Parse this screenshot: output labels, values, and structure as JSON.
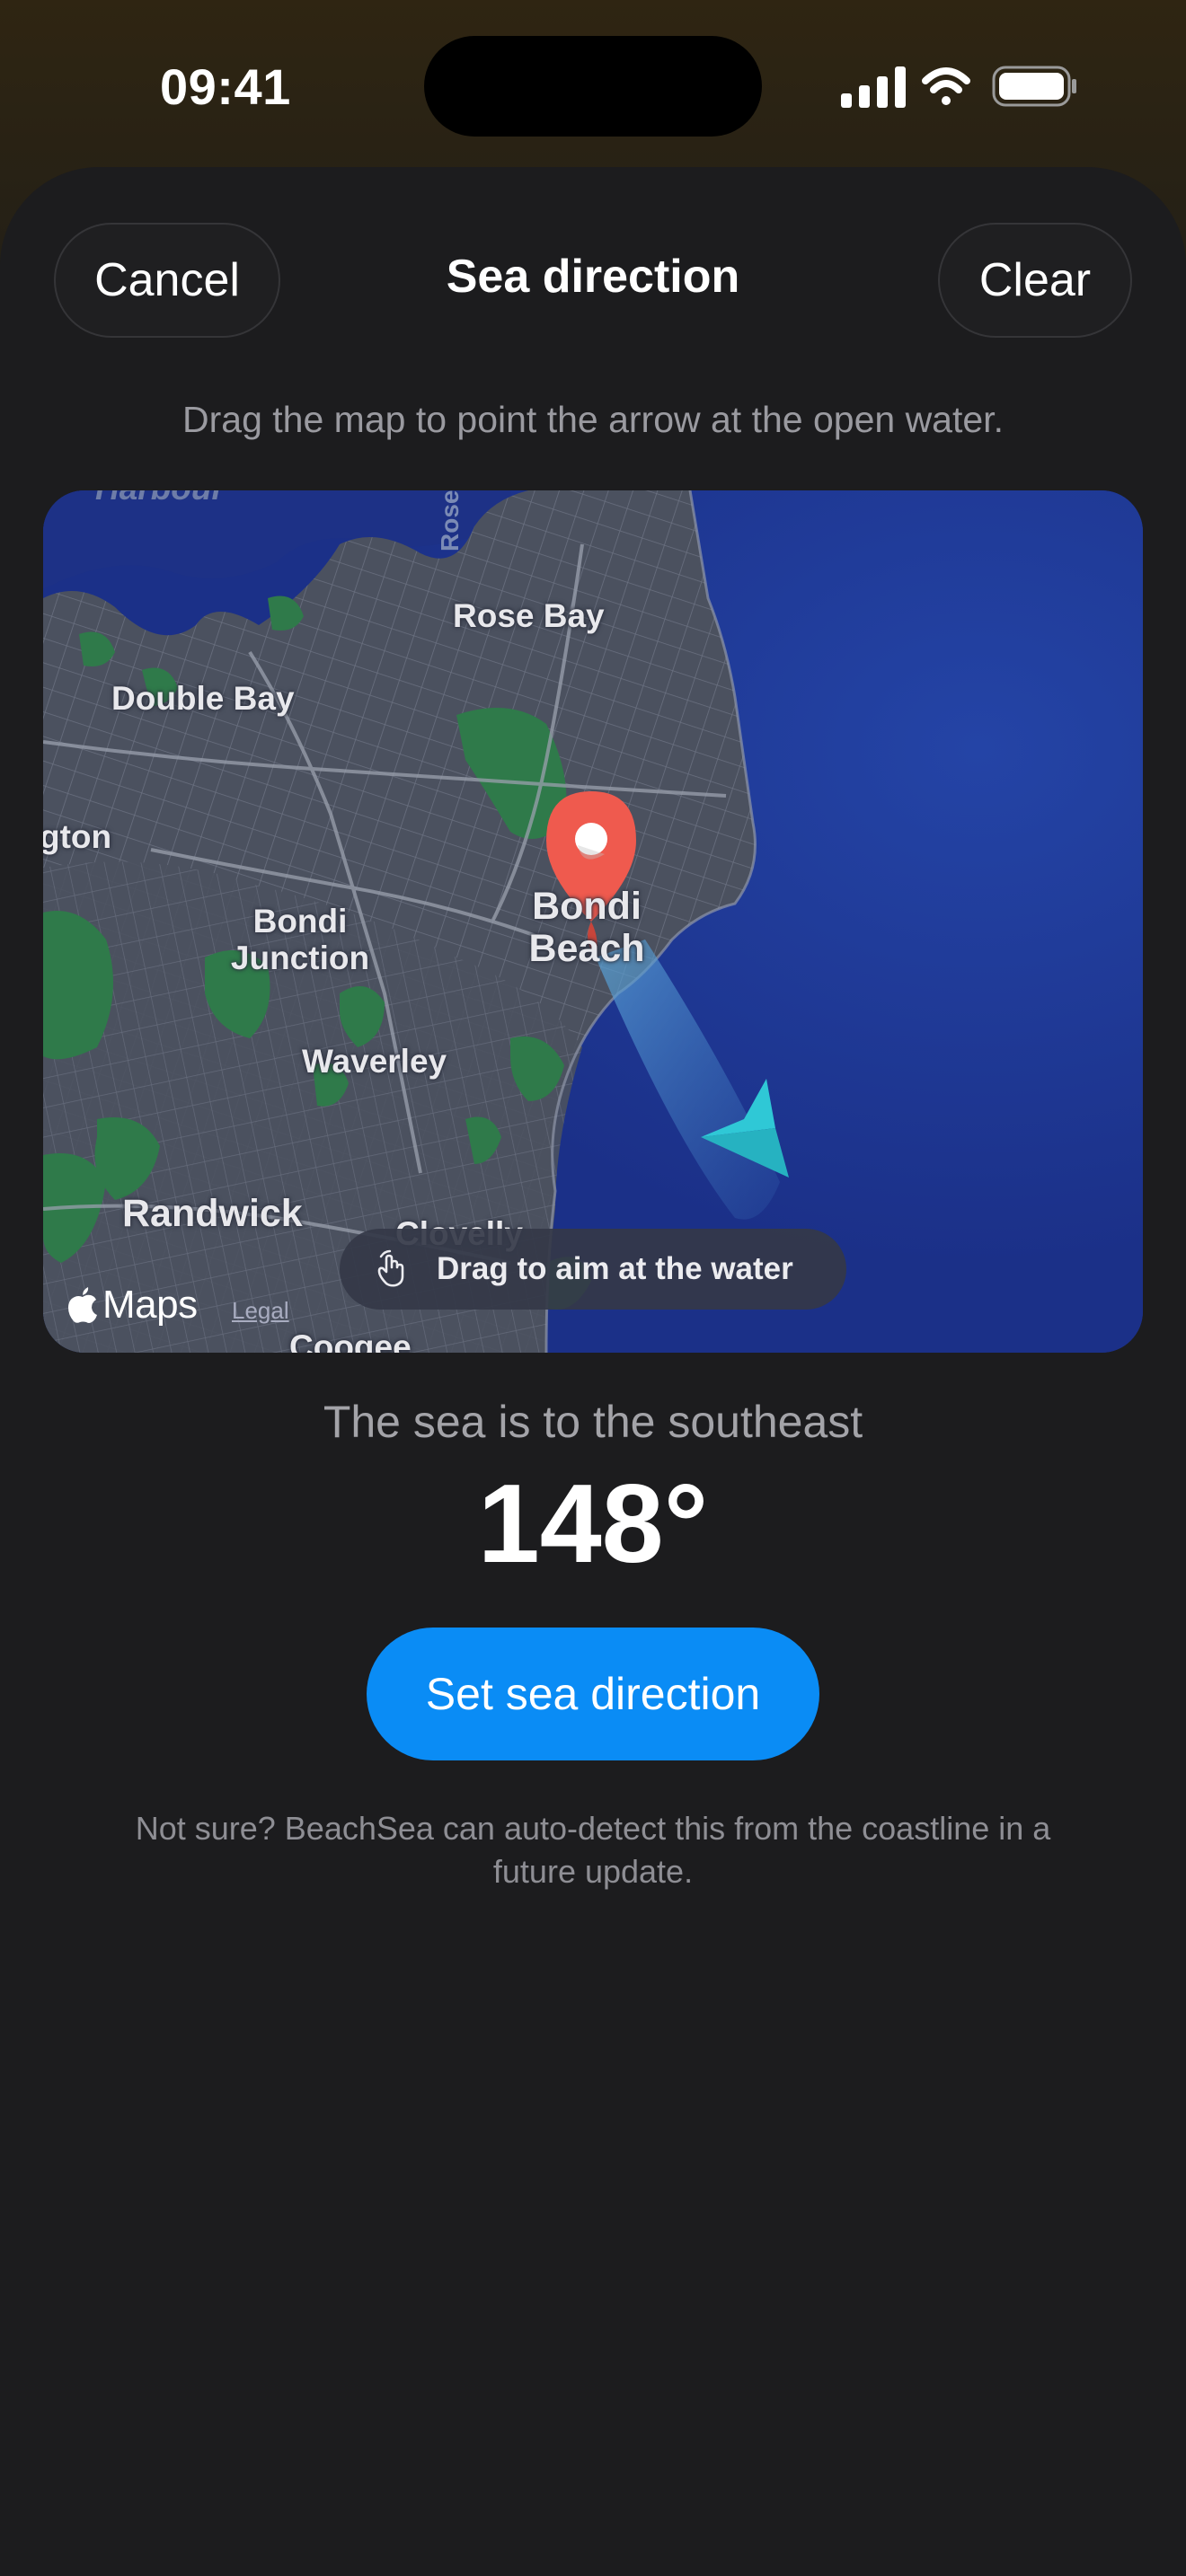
{
  "status_bar": {
    "time": "09:41"
  },
  "header": {
    "cancel_label": "Cancel",
    "title": "Sea direction",
    "clear_label": "Clear"
  },
  "instruction": "Drag the map to point the arrow at the open water.",
  "map": {
    "labels": {
      "harbour": "Harbour",
      "rose_bay_road": "Rose",
      "rose_bay": "Rose Bay",
      "double_bay": "Double Bay",
      "edgecliff": "gton",
      "bondi_junction": "Bondi\nJunction",
      "bondi_beach": "Bondi\nBeach",
      "waverley": "Waverley",
      "randwick": "Randwick",
      "clovelly": "Clovelly",
      "coogee": "Coogee"
    },
    "aim_hint": "Drag to aim at the water",
    "attribution_brand": "Maps",
    "legal": "Legal",
    "heading_degrees": 148,
    "colors": {
      "water": "#1d3388",
      "land": "#4a505e",
      "parks": "#2f7a4a",
      "pin": "#ef5a4e",
      "arrow": "#2fc8d6"
    }
  },
  "result": {
    "direction_text": "The sea is to the southeast",
    "degrees": "148°"
  },
  "set_button_label": "Set sea direction",
  "footnote": "Not sure? BeachSea can auto-detect this from the coastline in a future update.",
  "colors": {
    "accent": "#0a8cf5",
    "sheet": "#1c1c1e"
  }
}
